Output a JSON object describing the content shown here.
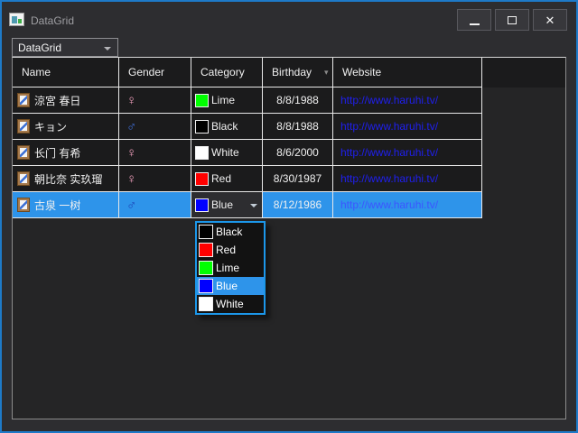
{
  "window": {
    "title": "DataGrid",
    "controls": {
      "close_glyph": "✕"
    }
  },
  "toolbar": {
    "combobox_value": "DataGrid"
  },
  "grid": {
    "columns": [
      {
        "label": "Name"
      },
      {
        "label": "Gender"
      },
      {
        "label": "Category"
      },
      {
        "label": "Birthday",
        "sort_glyph": "▾"
      },
      {
        "label": "Website"
      }
    ],
    "rows": [
      {
        "name": "涼宮 春日",
        "gender": "female",
        "gender_glyph": "♀",
        "category": {
          "label": "Lime",
          "color": "#00ff00"
        },
        "birthday": "8/8/1988",
        "website": "http://www.haruhi.tv/",
        "selected": false
      },
      {
        "name": "キョン",
        "gender": "male",
        "gender_glyph": "♂",
        "category": {
          "label": "Black",
          "color": "#000000"
        },
        "birthday": "8/8/1988",
        "website": "http://www.haruhi.tv/",
        "selected": false
      },
      {
        "name": "长门 有希",
        "gender": "female",
        "gender_glyph": "♀",
        "category": {
          "label": "White",
          "color": "#ffffff"
        },
        "birthday": "8/6/2000",
        "website": "http://www.haruhi.tv/",
        "selected": false
      },
      {
        "name": "朝比奈 实玖瑠",
        "gender": "female",
        "gender_glyph": "♀",
        "category": {
          "label": "Red",
          "color": "#ff0000"
        },
        "birthday": "8/30/1987",
        "website": "http://www.haruhi.tv/",
        "selected": false
      },
      {
        "name": "古泉 一树",
        "gender": "male",
        "gender_glyph": "♂",
        "category": {
          "label": "Blue",
          "color": "#0000ff"
        },
        "birthday": "8/12/1986",
        "website": "http://www.haruhi.tv/",
        "selected": true,
        "editing": true
      }
    ]
  },
  "dropdown": {
    "open_for_row": 4,
    "options": [
      {
        "label": "Black",
        "color": "#000000",
        "highlighted": false
      },
      {
        "label": "Red",
        "color": "#ff0000",
        "highlighted": false
      },
      {
        "label": "Lime",
        "color": "#00ff00",
        "highlighted": false
      },
      {
        "label": "Blue",
        "color": "#0000ff",
        "highlighted": true
      },
      {
        "label": "White",
        "color": "#ffffff",
        "highlighted": false
      }
    ]
  },
  "colors": {
    "window_border": "#1e7ac8",
    "window_background": "#2d2d30",
    "grid_background": "#252526",
    "cell_background": "#1b1b1c",
    "gridline": "#e8e8e8",
    "selection": "#2e94ea",
    "popup_border": "#1c97ea",
    "link": "#1f1ff0",
    "female": "#f2a0be",
    "male": "#3f6fd8"
  }
}
